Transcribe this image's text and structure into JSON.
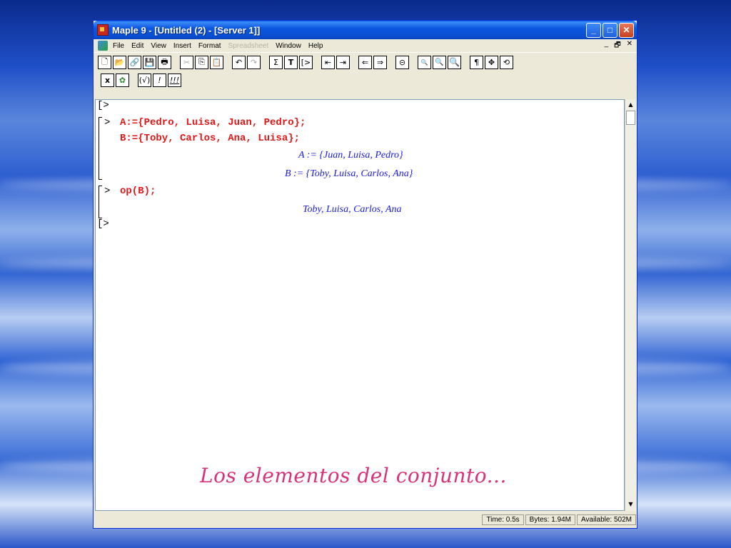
{
  "window": {
    "title": "Maple 9  - [Untitled (2) - [Server 1]]",
    "controls": {
      "minimize": "_",
      "maximize": "□",
      "close": "✕"
    }
  },
  "menu": {
    "items": [
      "File",
      "Edit",
      "View",
      "Insert",
      "Format",
      "Spreadsheet",
      "Window",
      "Help"
    ],
    "disabled": [
      "Spreadsheet"
    ],
    "mdi": {
      "minimize": "_",
      "restore": "🗗",
      "close": "✕"
    }
  },
  "toolbar": {
    "buttons": [
      "new-icon",
      "open-icon",
      "open-url-icon",
      "save-icon",
      "print-icon",
      "cut-icon",
      "copy-icon",
      "paste-icon",
      "undo-icon",
      "redo-icon",
      "sum-icon",
      "text-icon",
      "prompt-icon",
      "indent-icon",
      "outdent-icon",
      "back-icon",
      "forward-icon",
      "stop-icon",
      "zoom-small-icon",
      "zoom-medium-icon",
      "zoom-large-icon",
      "pilcrow-icon",
      "move-icon",
      "restart-icon"
    ]
  },
  "toolbar2": {
    "buttons": [
      "x-icon",
      "debug-icon",
      "check-icon",
      "exec-icon",
      "exec-all-icon"
    ]
  },
  "worksheet": {
    "prompt": "[>",
    "group1": {
      "input1": "A:={Pedro, Luisa, Juan, Pedro};",
      "input2": "B:={Toby, Carlos, Ana, Luisa};",
      "output1": "A := {Juan, Luisa, Pedro}",
      "output2": "B := {Toby, Luisa, Carlos, Ana}"
    },
    "group2": {
      "input": "op(B);",
      "output": "Toby, Luisa, Carlos, Ana"
    },
    "caption": "Los elementos del conjunto..."
  },
  "status": {
    "time": "Time:  0.5s",
    "bytes": "Bytes: 1.94M",
    "available": "Available: 502M"
  },
  "colors": {
    "input": "#e01818",
    "output": "#1a1ae0",
    "caption": "#d8327a"
  }
}
